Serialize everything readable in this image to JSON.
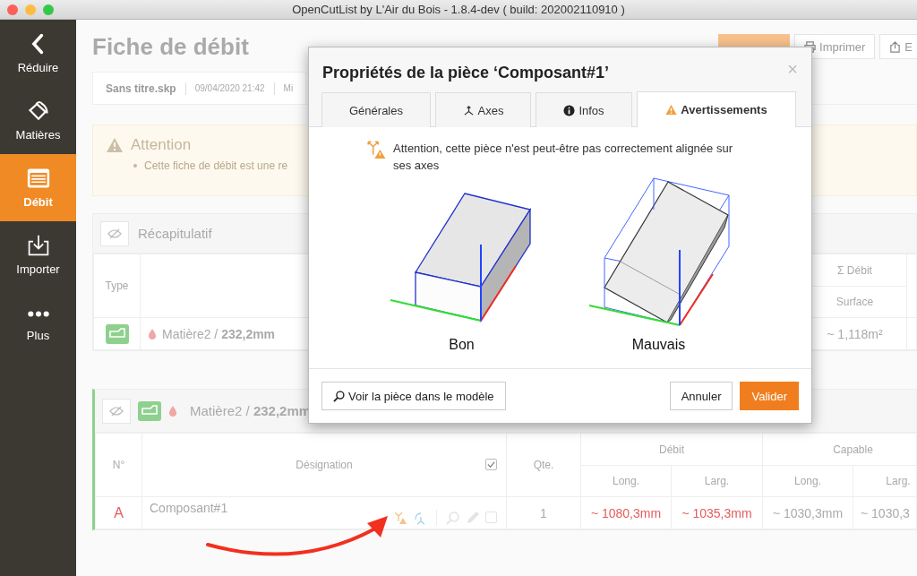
{
  "window": {
    "title": "OpenCutList by L'Air du Bois - 1.8.4-dev ( build: 202002110910 )"
  },
  "sidebar": {
    "items": [
      {
        "label": "Réduire",
        "selected": false
      },
      {
        "label": "Matières",
        "selected": false
      },
      {
        "label": "Débit",
        "selected": true
      },
      {
        "label": "Importer",
        "selected": false
      },
      {
        "label": "Plus",
        "selected": false
      }
    ]
  },
  "page": {
    "title": "Fiche de débit",
    "buttons": [
      "Imprimer",
      "E"
    ]
  },
  "file_bar": [
    "Sans titre.skp",
    "09/04/2020 21:42",
    "Mi"
  ],
  "alert": {
    "title": "Attention",
    "items": [
      "Cette fiche de débit est une re"
    ]
  },
  "summary": {
    "title": "Récapitulatif",
    "type_header": "Type",
    "group_header": "Σ Débit",
    "sub_header": "Surface",
    "rows": [
      {
        "material": "Matière2 / **232,2mm**",
        "surface": "~ 1,118m²"
      }
    ]
  },
  "group": {
    "material": "Matière2 / **232,2mm**",
    "number_header": "N°",
    "name_header": "Désignation",
    "select_all_checked": true,
    "qty_header": "Qte.",
    "cut_header": "Débit",
    "bbox_header": "Capable",
    "sub_headers": [
      "Long.",
      "Larg.",
      "Long.",
      "Larg."
    ],
    "rows": [
      {
        "number": "A",
        "name": "Composant#1",
        "checked": false,
        "qty": "1",
        "cut_length": "~ 1080,3mm",
        "cut_width": "~ 1035,3mm",
        "bbox_length": "~ 1030,3mm",
        "bbox_width": "~ 1030,3"
      }
    ]
  },
  "dialog": {
    "title": "Propriétés de la pièce ‘Composant#1’",
    "close": "×",
    "tabs": [
      {
        "label": "Générales",
        "selected": false
      },
      {
        "label": "Axes",
        "selected": false
      },
      {
        "label": "Infos",
        "selected": false
      },
      {
        "label": "Avertissements",
        "selected": true
      }
    ],
    "warning": "Attention, cette pièce n'est peut-être pas correctement alignée sur ses axes",
    "examples": [
      "Bon",
      "Mauvais"
    ],
    "view_button": "Voir la pièce dans le modèle",
    "cancel_button": "Annuler",
    "ok_button": "Valider"
  }
}
